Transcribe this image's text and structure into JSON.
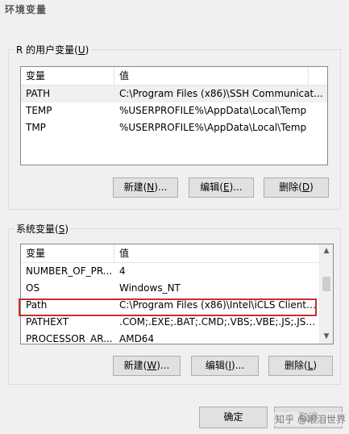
{
  "window": {
    "title": "环境变量"
  },
  "user_vars": {
    "label": "R 的用户变量(",
    "label_hotkey": "U",
    "label_end": ")",
    "columns": [
      "变量",
      "值"
    ],
    "rows": [
      {
        "name": "PATH",
        "value": "C:\\Program Files (x86)\\SSH Communicat..."
      },
      {
        "name": "TEMP",
        "value": "%USERPROFILE%\\AppData\\Local\\Temp"
      },
      {
        "name": "TMP",
        "value": "%USERPROFILE%\\AppData\\Local\\Temp"
      }
    ],
    "buttons": {
      "new": {
        "pre": "新建(",
        "key": "N",
        "post": ")..."
      },
      "edit": {
        "pre": "编辑(",
        "key": "E",
        "post": ")..."
      },
      "delete": {
        "pre": "删除(",
        "key": "D",
        "post": ")"
      }
    }
  },
  "system_vars": {
    "label": "系统变量(",
    "label_hotkey": "S",
    "label_end": ")",
    "columns": [
      "变量",
      "值"
    ],
    "rows": [
      {
        "name": "NUMBER_OF_PR...",
        "value": "4"
      },
      {
        "name": "OS",
        "value": "Windows_NT"
      },
      {
        "name": "Path",
        "value": "C:\\Program Files (x86)\\Intel\\iCLS Client\\;..."
      },
      {
        "name": "PATHEXT",
        "value": ".COM;.EXE;.BAT;.CMD;.VBS;.VBE;.JS;.JSE;..."
      },
      {
        "name": "PROCESSOR_AR...",
        "value": "AMD64"
      }
    ],
    "buttons": {
      "new": {
        "pre": "新建(",
        "key": "W",
        "post": ")..."
      },
      "edit": {
        "pre": "编辑(",
        "key": "I",
        "post": ")..."
      },
      "delete": {
        "pre": "删除(",
        "key": "L",
        "post": ")"
      }
    }
  },
  "footer": {
    "ok": "确定",
    "cancel": "取消"
  },
  "watermark": "知乎 @眼泪世界",
  "colors": {
    "highlight": "#c8302b",
    "list_border": "#828790",
    "button_face": "#e1e1e1"
  }
}
